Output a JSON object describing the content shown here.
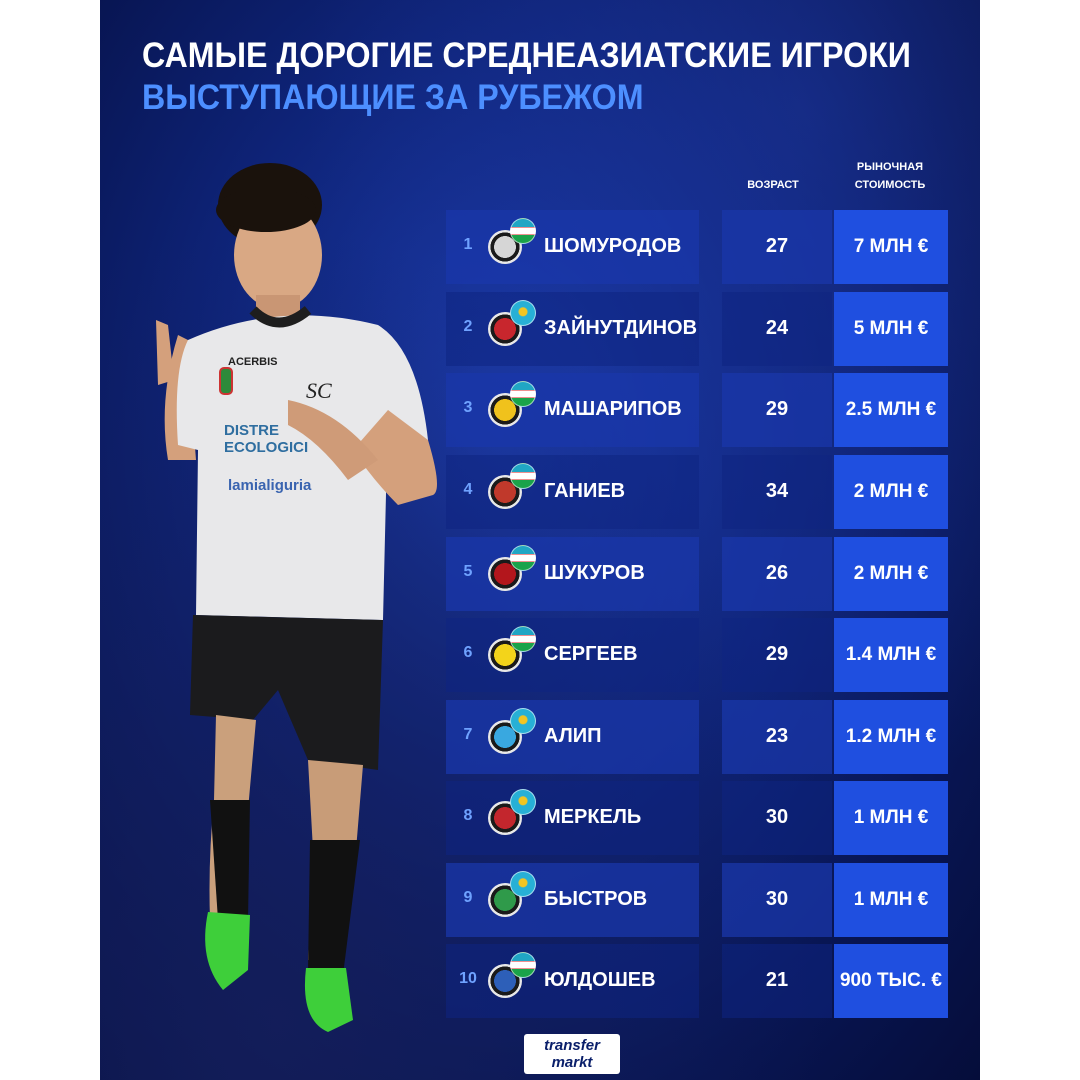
{
  "title_line1": "САМЫЕ ДОРОГИЕ СРЕДНЕАЗИАТСКИЕ ИГРОКИ",
  "title_line2": "ВЫСТУПАЮЩИЕ ЗА РУБЕЖОМ",
  "headers": {
    "age": "ВОЗРАСТ",
    "value_line1": "РЫНОЧНАЯ",
    "value_line2": "СТОИМОСТЬ"
  },
  "colors": {
    "title": "#ffffff",
    "subtitle": "#4d8fff",
    "value_box": "#1f4fe0",
    "rank": "#6fa2ff"
  },
  "shirt_text": {
    "sponsor": "ACERBIS",
    "club": "SC",
    "ad1": "DISTRE",
    "ad2": "ECOLOGICI",
    "ad3": "lamialiguria"
  },
  "players": [
    {
      "rank": "1",
      "name": "ШОМУРОДОВ",
      "age": "27",
      "value": "7 МЛН €",
      "flag": "uz",
      "club_logo": "spezia-logo"
    },
    {
      "rank": "2",
      "name": "ЗАЙНУТДИНОВ",
      "age": "24",
      "value": "5 МЛН €",
      "flag": "kz",
      "club_logo": "cska-logo"
    },
    {
      "rank": "3",
      "name": "МАШАРИПОВ",
      "age": "29",
      "value": "2.5 МЛН €",
      "flag": "uz",
      "club_logo": "al-nassr-logo"
    },
    {
      "rank": "4",
      "name": "ГАНИЕВ",
      "age": "34",
      "value": "2 МЛН €",
      "flag": "uz",
      "club_logo": "club-logo"
    },
    {
      "rank": "5",
      "name": "ШУКУРОВ",
      "age": "26",
      "value": "2 МЛН €",
      "flag": "uz",
      "club_logo": "club-logo"
    },
    {
      "rank": "6",
      "name": "СЕРГЕЕВ",
      "age": "29",
      "value": "1.4 МЛН €",
      "flag": "uz",
      "club_logo": "club-logo"
    },
    {
      "rank": "7",
      "name": "АЛИП",
      "age": "23",
      "value": "1.2 МЛН €",
      "flag": "kz",
      "club_logo": "zenit-logo"
    },
    {
      "rank": "8",
      "name": "МЕРКЕЛЬ",
      "age": "30",
      "value": "1 МЛН €",
      "flag": "kz",
      "club_logo": "club-logo"
    },
    {
      "rank": "9",
      "name": "БЫСТРОВ",
      "age": "30",
      "value": "1 МЛН €",
      "flag": "kz",
      "club_logo": "akhmat-logo"
    },
    {
      "rank": "10",
      "name": "ЮЛДОШЕВ",
      "age": "21",
      "value": "900 ТЫС. €",
      "flag": "uz",
      "club_logo": "club-logo"
    }
  ],
  "brand": {
    "line1": "transfer",
    "line2": "markt"
  }
}
